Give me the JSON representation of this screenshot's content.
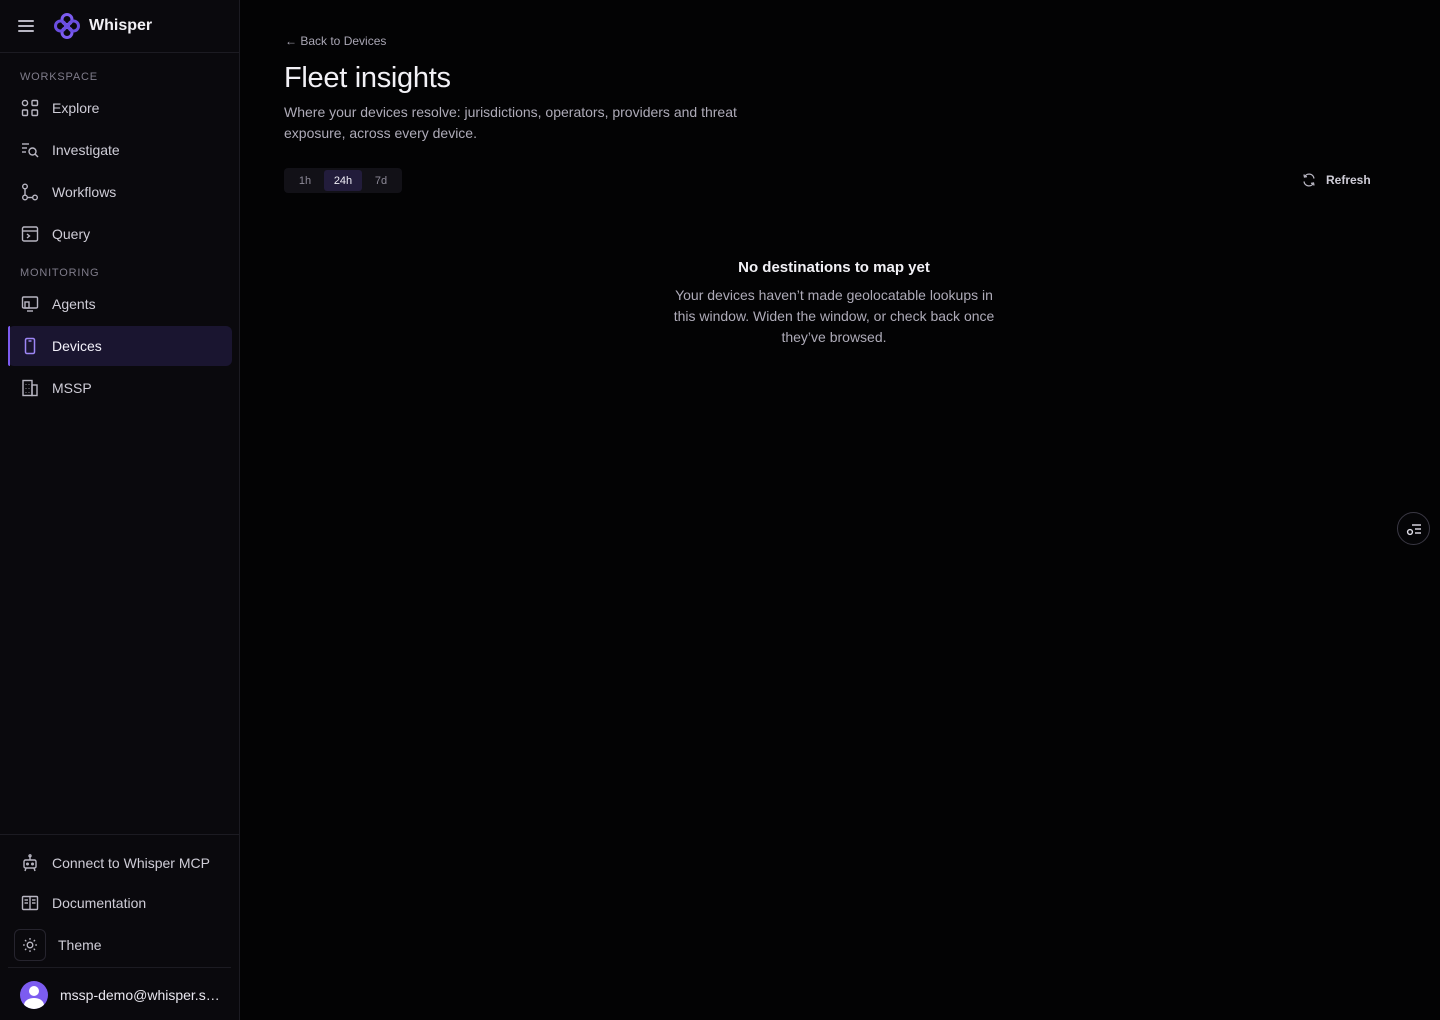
{
  "app": {
    "name": "Whisper"
  },
  "sidebar": {
    "sections": [
      {
        "title": "Workspace"
      },
      {
        "title": "Monitoring"
      }
    ],
    "items": [
      {
        "label": "Explore",
        "icon": "grid-icon"
      },
      {
        "label": "Investigate",
        "icon": "investigate-icon"
      },
      {
        "label": "Workflows",
        "icon": "workflow-icon"
      },
      {
        "label": "Query",
        "icon": "query-icon"
      },
      {
        "label": "Agents",
        "icon": "agents-icon"
      },
      {
        "label": "Devices",
        "icon": "device-icon",
        "active": true
      },
      {
        "label": "MSSP",
        "icon": "building-icon"
      }
    ],
    "footer": {
      "mcp_label": "Connect to Whisper MCP",
      "docs_label": "Documentation",
      "theme_label": "Theme",
      "user_email": "mssp-demo@whisper.security"
    }
  },
  "main": {
    "back_link": "← Back to Devices",
    "title": "Fleet insights",
    "description": "Where your devices resolve: jurisdictions, operators, providers and threat exposure, across every device.",
    "time_ranges": [
      "1h",
      "24h",
      "7d"
    ],
    "selected_range": "24h",
    "refresh_label": "Refresh",
    "empty_state": {
      "title": "No destinations to map yet",
      "body": "Your devices haven’t made geolocatable lookups in this window. Widen the window, or check back once they’ve browsed."
    }
  },
  "colors": {
    "accent": "#7c5cf0",
    "background": "#030304",
    "sidebar": "#0a090d",
    "active_item": "#1a1530"
  }
}
